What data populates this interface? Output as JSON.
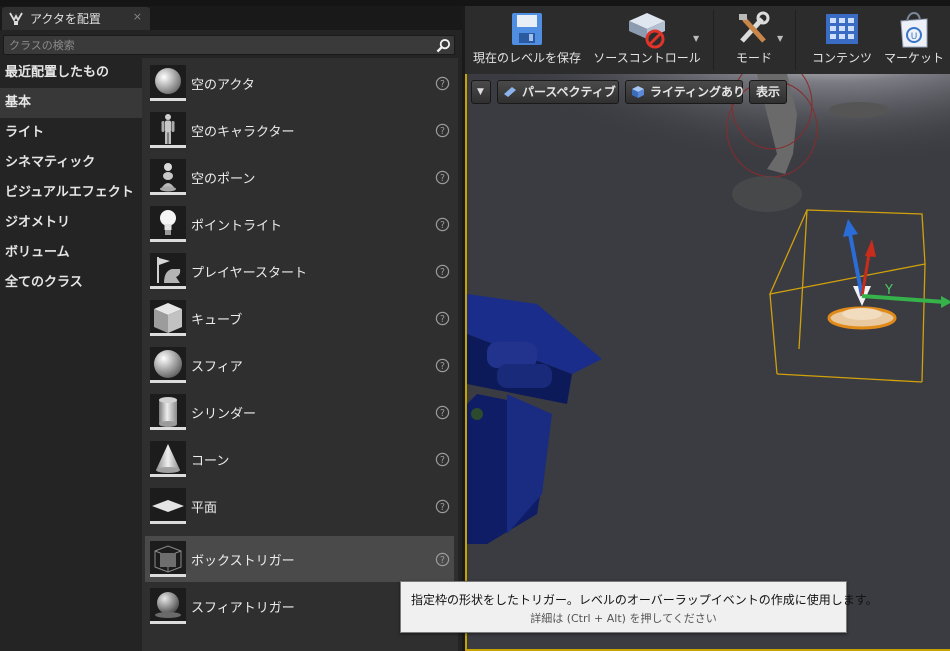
{
  "panel": {
    "tab_title": "アクタを配置",
    "tab_icon": "place-actors-icon",
    "close_glyph": "×",
    "search": {
      "placeholder": "クラスの検索",
      "value": ""
    },
    "categories": [
      {
        "label": "最近配置したもの",
        "active": false
      },
      {
        "label": "基本",
        "active": true
      },
      {
        "label": "ライト",
        "active": false
      },
      {
        "label": "シネマティック",
        "active": false
      },
      {
        "label": "ビジュアルエフェクト",
        "active": false
      },
      {
        "label": "ジオメトリ",
        "active": false
      },
      {
        "label": "ボリューム",
        "active": false
      },
      {
        "label": "全てのクラス",
        "active": false
      }
    ],
    "actors": [
      {
        "label": "空のアクタ",
        "icon": "empty-actor-sphere-icon"
      },
      {
        "label": "空のキャラクター",
        "icon": "empty-character-mannequin-icon"
      },
      {
        "label": "空のポーン",
        "icon": "empty-pawn-icon"
      },
      {
        "label": "ポイントライト",
        "icon": "point-light-bulb-icon"
      },
      {
        "label": "プレイヤースタート",
        "icon": "player-start-flag-icon"
      },
      {
        "label": "キューブ",
        "icon": "cube-icon"
      },
      {
        "label": "スフィア",
        "icon": "sphere-icon"
      },
      {
        "label": "シリンダー",
        "icon": "cylinder-icon"
      },
      {
        "label": "コーン",
        "icon": "cone-icon"
      },
      {
        "label": "平面",
        "icon": "plane-icon"
      },
      {
        "label": "ボックストリガー",
        "icon": "box-trigger-icon",
        "hover": true
      },
      {
        "label": "スフィアトリガー",
        "icon": "sphere-trigger-icon"
      }
    ]
  },
  "toolbar": {
    "save_label": "現在のレベルを保存",
    "source_control_label": "ソースコントロール",
    "modes_label": "モード",
    "content_label": "コンテンツ",
    "marketplace_label": "マーケット"
  },
  "viewport": {
    "perspective_label": "パースペクティブ",
    "lighting_label": "ライティングあり",
    "show_label": "表示",
    "gizmo_x_label": "Y",
    "selection_color": "#c5a300"
  },
  "tooltip": {
    "text": "指定枠の形状をしたトリガー。レベルのオーバーラップイベントの作成に使用します。",
    "hint": "詳細は (Ctrl + Alt) を押してください"
  }
}
